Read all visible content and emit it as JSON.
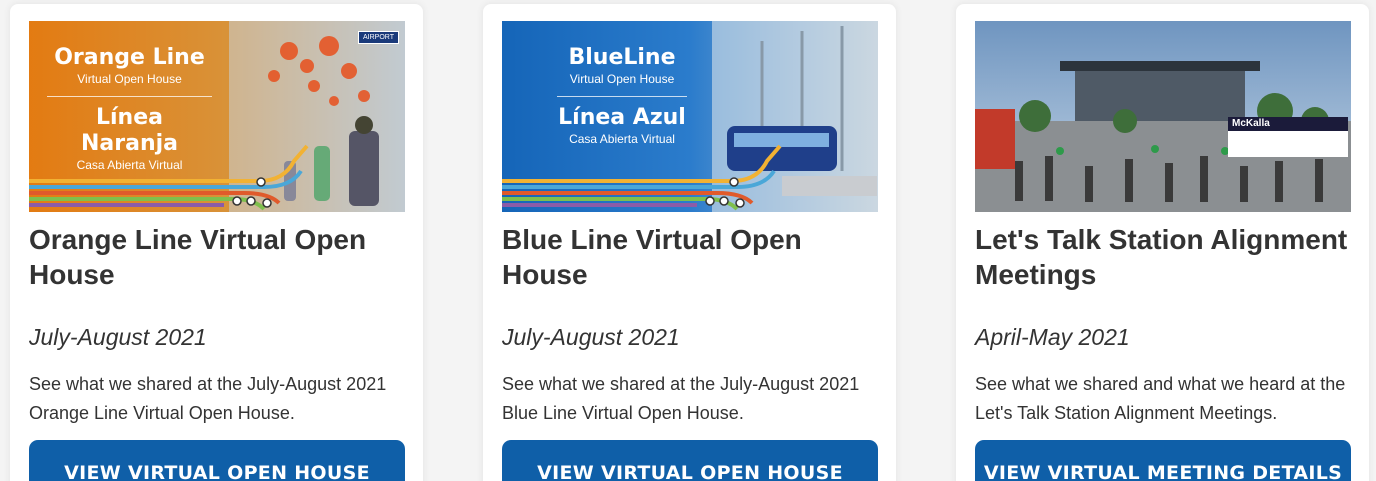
{
  "cards": [
    {
      "thumb": {
        "en_title": "Orange Line",
        "en_sub": "Virtual Open House",
        "es_title": "Línea Naranja",
        "es_sub": "Casa Abierta Virtual",
        "tag": "AIRPORT",
        "bg_color": "#e07b1a"
      },
      "title": "Orange Line Virtual Open House",
      "date": "July-August 2021",
      "description": "See what we shared at the July-August 2021 Orange Line Virtual Open House.",
      "button_label": "VIEW VIRTUAL OPEN HOUSE DETAILS"
    },
    {
      "thumb": {
        "en_title": "BlueLine",
        "en_sub": "Virtual Open House",
        "es_title": "Línea Azul",
        "es_sub": "Casa Abierta Virtual",
        "bg_color": "#1a6fc0"
      },
      "title": "Blue Line Virtual Open House",
      "date": "July-August 2021",
      "description": "See what we shared at the July-August 2021 Blue Line Virtual Open House.",
      "button_label": "VIEW VIRTUAL OPEN HOUSE DETAILS"
    },
    {
      "thumb": {
        "sign": "McKalla"
      },
      "title": "Let's Talk Station Alignment Meetings",
      "date": "April-May 2021",
      "description": "See what we shared and what we heard at the Let's Talk Station Alignment Meetings.",
      "button_label": "VIEW VIRTUAL MEETING DETAILS"
    }
  ],
  "colors": {
    "button": "#0f5fa8",
    "text": "#333333",
    "card": "#ffffff",
    "page": "#f4f4f4"
  }
}
